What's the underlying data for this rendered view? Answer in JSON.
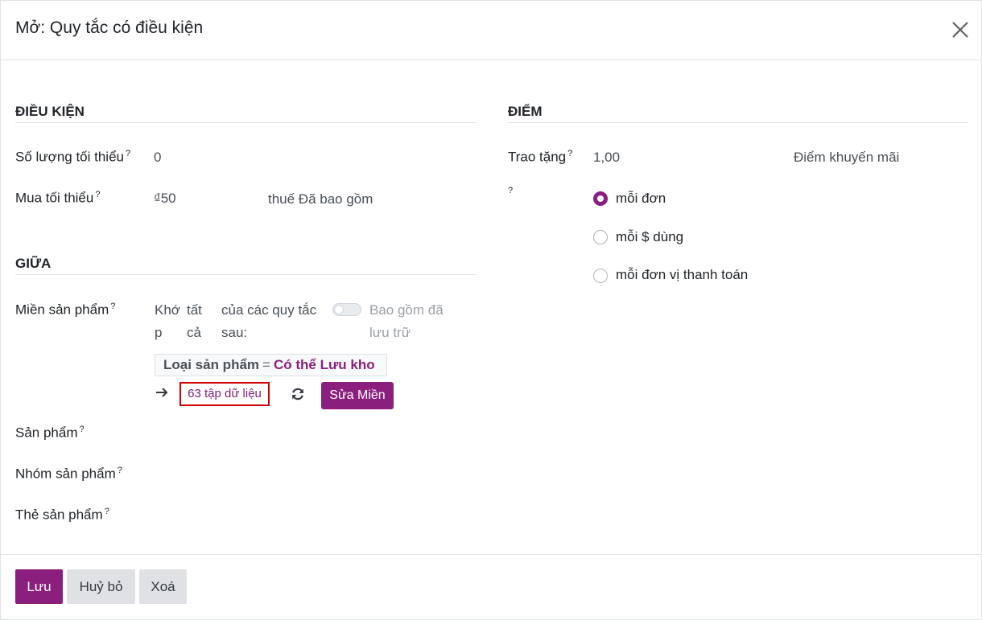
{
  "dialog": {
    "title": "Mở: Quy tắc có điều kiện"
  },
  "conditions": {
    "section_title": "ĐIỀU KIỆN",
    "min_qty_label": "Số lượng tối thiểu",
    "min_qty_value": "0",
    "min_purchase_label": "Mua tối thiểu",
    "min_purchase_value": "₫50",
    "tax_text": "thuế Đã bao gồm"
  },
  "among": {
    "section_title": "GIỮA",
    "product_domain_label": "Miền sản phẩm",
    "match_word1": "Khớ",
    "match_word1b": "p",
    "match_word2": "tất",
    "match_word2b": "cả",
    "rules_text1": "của các quy tắc",
    "rules_text2": "sau:",
    "archived_text1": "Bao gồm đã",
    "archived_text2": "lưu trữ",
    "domain_field": "Loại sản phẩm",
    "domain_operator": "=",
    "domain_value": "Có thể Lưu kho",
    "records_link": "63 tập dữ liệu",
    "edit_domain_button": "Sửa Miền",
    "products_label": "Sản phẩm",
    "product_category_label": "Nhóm sản phẩm",
    "product_tags_label": "Thẻ sản phẩm"
  },
  "points": {
    "section_title": "ĐIỂM",
    "grant_label": "Trao tặng",
    "grant_value": "1,00",
    "points_unit": "Điểm khuyến mãi",
    "mode_help": "?",
    "options": [
      "mỗi đơn",
      "mỗi $ dùng",
      "mỗi đơn vị thanh toán"
    ],
    "selected_index": 0
  },
  "help_marker": "?",
  "footer": {
    "save": "Lưu",
    "discard": "Huỷ bỏ",
    "delete": "Xoá"
  },
  "colors": {
    "accent": "#8b1f7e",
    "highlight_border": "#d00000"
  }
}
